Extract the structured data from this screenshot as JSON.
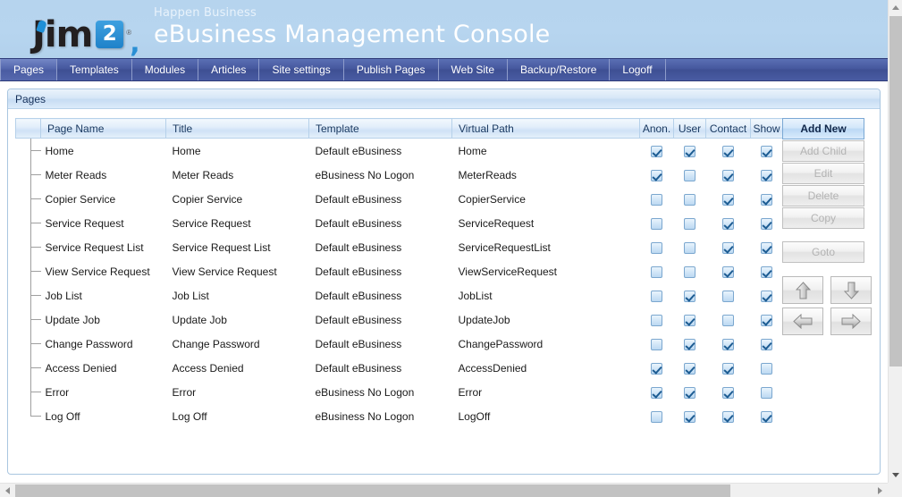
{
  "banner": {
    "logo_text": "Jim",
    "logo_badge": "2",
    "logo_reg": "®",
    "tagline": "Happen Business",
    "title": "eBusiness Management Console"
  },
  "nav": {
    "items": [
      {
        "label": "Pages",
        "active": true
      },
      {
        "label": "Templates",
        "active": false
      },
      {
        "label": "Modules",
        "active": false
      },
      {
        "label": "Articles",
        "active": false
      },
      {
        "label": "Site settings",
        "active": false
      },
      {
        "label": "Publish Pages",
        "active": false
      },
      {
        "label": "Web Site",
        "active": false
      },
      {
        "label": "Backup/Restore",
        "active": false
      },
      {
        "label": "Logoff",
        "active": false
      }
    ]
  },
  "panel": {
    "title": "Pages"
  },
  "grid": {
    "columns": [
      "Page Name",
      "Title",
      "Template",
      "Virtual Path",
      "Anon.",
      "User",
      "Contact",
      "Show"
    ],
    "rows": [
      {
        "page_name": "Home",
        "title": "Home",
        "template": "Default eBusiness",
        "virtual_path": "Home",
        "anon": true,
        "user": true,
        "contact": true,
        "show": true
      },
      {
        "page_name": "Meter Reads",
        "title": "Meter Reads",
        "template": "eBusiness No Logon",
        "virtual_path": "MeterReads",
        "anon": true,
        "user": false,
        "contact": true,
        "show": true
      },
      {
        "page_name": "Copier Service",
        "title": "Copier Service",
        "template": "Default eBusiness",
        "virtual_path": "CopierService",
        "anon": false,
        "user": false,
        "contact": true,
        "show": true
      },
      {
        "page_name": "Service Request",
        "title": "Service Request",
        "template": "Default eBusiness",
        "virtual_path": "ServiceRequest",
        "anon": false,
        "user": false,
        "contact": true,
        "show": true
      },
      {
        "page_name": "Service Request List",
        "title": "Service Request List",
        "template": "Default eBusiness",
        "virtual_path": "ServiceRequestList",
        "anon": false,
        "user": false,
        "contact": true,
        "show": true
      },
      {
        "page_name": "View Service Request",
        "title": "View Service Request",
        "template": "Default eBusiness",
        "virtual_path": "ViewServiceRequest",
        "anon": false,
        "user": false,
        "contact": true,
        "show": true
      },
      {
        "page_name": "Job List",
        "title": "Job List",
        "template": "Default eBusiness",
        "virtual_path": "JobList",
        "anon": false,
        "user": true,
        "contact": false,
        "show": true
      },
      {
        "page_name": "Update Job",
        "title": "Update Job",
        "template": "Default eBusiness",
        "virtual_path": "UpdateJob",
        "anon": false,
        "user": true,
        "contact": false,
        "show": true
      },
      {
        "page_name": "Change Password",
        "title": "Change Password",
        "template": "Default eBusiness",
        "virtual_path": "ChangePassword",
        "anon": false,
        "user": true,
        "contact": true,
        "show": true
      },
      {
        "page_name": "Access Denied",
        "title": "Access Denied",
        "template": "Default eBusiness",
        "virtual_path": "AccessDenied",
        "anon": true,
        "user": true,
        "contact": true,
        "show": false
      },
      {
        "page_name": "Error",
        "title": "Error",
        "template": "eBusiness No Logon",
        "virtual_path": "Error",
        "anon": true,
        "user": true,
        "contact": true,
        "show": false
      },
      {
        "page_name": "Log Off",
        "title": "Log Off",
        "template": "eBusiness No Logon",
        "virtual_path": "LogOff",
        "anon": false,
        "user": true,
        "contact": true,
        "show": true
      }
    ]
  },
  "buttons": {
    "add_new": "Add New",
    "add_child": "Add Child",
    "edit": "Edit",
    "delete": "Delete",
    "copy": "Copy",
    "goto": "Goto"
  },
  "arrows": {
    "up": "move-up",
    "down": "move-down",
    "left": "move-left",
    "right": "move-right"
  },
  "colors": {
    "banner_bg": "#b6d4ee",
    "nav_bg": "#46589e",
    "panel_border": "#a9c6e0",
    "grid_header": "#cfe2f6",
    "checkbox_check": "#1d5c92",
    "accent_blue": "#1f82c9"
  }
}
